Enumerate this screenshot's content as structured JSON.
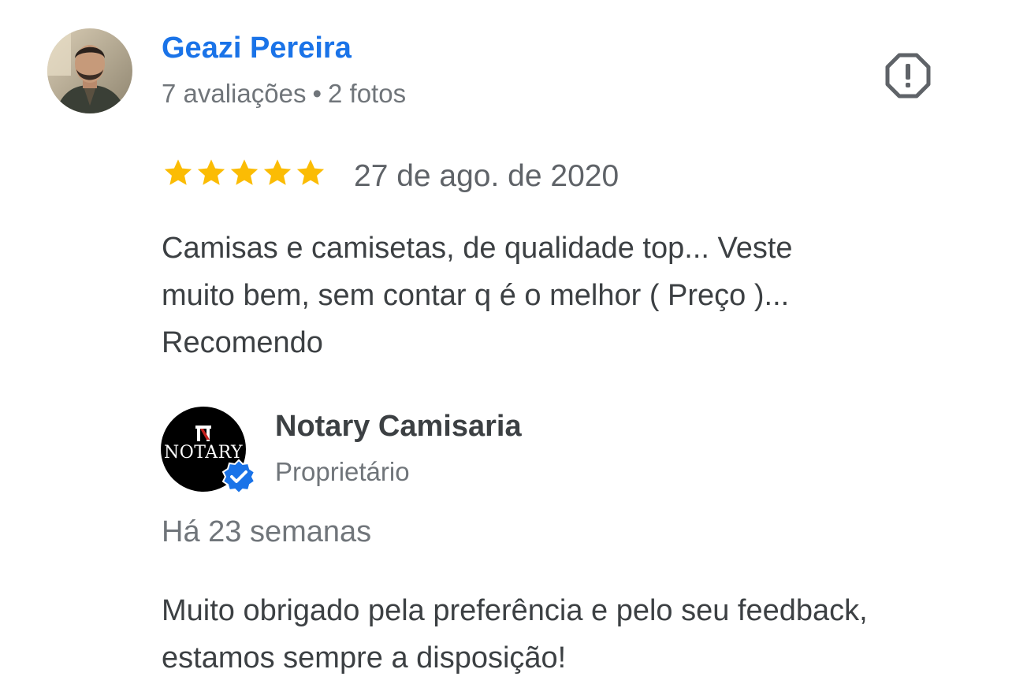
{
  "review": {
    "reviewer_name": "Geazi Pereira",
    "reviews_count": "7 avaliações",
    "separator": "•",
    "photos_count": "2 fotos",
    "rating": 5,
    "rating_max": 5,
    "date": "27 de ago. de 2020",
    "text_lines": [
      "Camisas e camisetas, de qualidade top... Veste",
      "muito bem, sem contar q é o melhor ( Preço )...",
      "Recomendo"
    ],
    "report_icon": "report-flag-icon"
  },
  "owner_reply": {
    "owner_name": "Notary Camisaria",
    "logo_text": "NOTARY",
    "role": "Proprietário",
    "time_ago": "Há 23 semanas",
    "text_lines": [
      "Muito obrigado pela preferência e pelo seu feedback,",
      "estamos sempre a disposição!"
    ],
    "verified_icon": "verified-badge-icon"
  },
  "colors": {
    "reviewer_name": "#1a73e8",
    "star": "#fbbc04",
    "verified": "#1a73e8",
    "text": "#3c4043",
    "secondary": "#70757a",
    "logo_accent": "#c5221f"
  }
}
